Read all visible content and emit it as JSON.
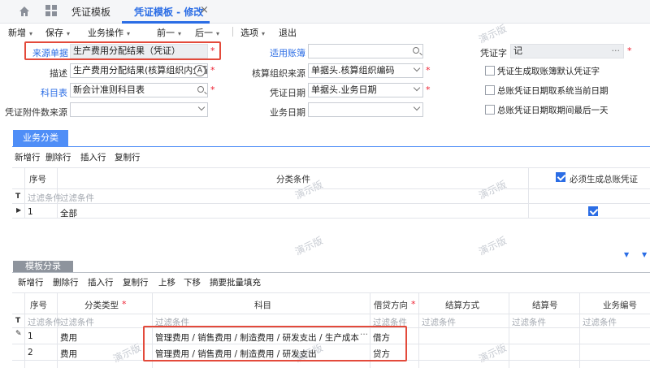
{
  "tabs": {
    "first": "凭证模板",
    "second": "凭证模板 - 修改",
    "close": "×"
  },
  "toolbar": {
    "items": [
      "新增",
      "保存",
      "业务操作",
      "前一",
      "后一",
      "选项",
      "退出"
    ]
  },
  "form": {
    "source_doc": {
      "label": "来源单据",
      "value": "生产费用分配结果（凭证）"
    },
    "ledger": {
      "label": "适用账簿",
      "value": ""
    },
    "voucher_word": {
      "label": "凭证字",
      "value": "记",
      "more": "···"
    },
    "description": {
      "label": "描述",
      "value": "生产费用分配结果(核算组织内分配)"
    },
    "org_source": {
      "label": "核算组织来源",
      "value": "单据头.核算组织编码"
    },
    "subject_table": {
      "label": "科目表",
      "value": "新会计准则科目表"
    },
    "voucher_date": {
      "label": "凭证日期",
      "value": "单据头.业务日期"
    },
    "attachment_source": {
      "label": "凭证附件数来源",
      "value": ""
    },
    "business_date": {
      "label": "业务日期",
      "value": ""
    },
    "checkboxes": [
      "凭证生成取账簿默认凭证字",
      "总账凭证日期取系统当前日期",
      "总账凭证日期取期间最后一天"
    ],
    "required_mark": "*"
  },
  "business_section": {
    "tab": "业务分类",
    "actions": [
      "新增行",
      "删除行",
      "插入行",
      "复制行"
    ],
    "headers": {
      "seq": "序号",
      "condition": "分类条件",
      "must": "必须生成总账凭证"
    },
    "filter_text": "过滤条件",
    "rows": [
      {
        "seq": "1",
        "condition": "全部",
        "must": true
      }
    ]
  },
  "template_section": {
    "tab": "模板分录",
    "actions": [
      "新增行",
      "删除行",
      "插入行",
      "复制行",
      "上移",
      "下移",
      "摘要批量填充"
    ],
    "headers": {
      "seq": "序号",
      "type": "分类类型",
      "subject": "科目",
      "direction": "借贷方向",
      "settle_method": "结算方式",
      "settle_no": "结算号",
      "biz_no": "业务编号"
    },
    "filter_text": "过滤条件",
    "rows": [
      {
        "seq": "1",
        "type": "费用",
        "subject": "管理费用 / 销售费用 / 制造费用 / 研发支出 / 生产成本",
        "direction": "借方",
        "more": "···"
      },
      {
        "seq": "2",
        "type": "费用",
        "subject": "管理费用 / 销售费用 / 制造费用 / 研发支出",
        "direction": "贷方"
      }
    ]
  },
  "watermark": "演示版",
  "colors": {
    "accent": "#2b6de5",
    "highlight": "#e34a3b",
    "tab_active": "#4f8ef7"
  }
}
